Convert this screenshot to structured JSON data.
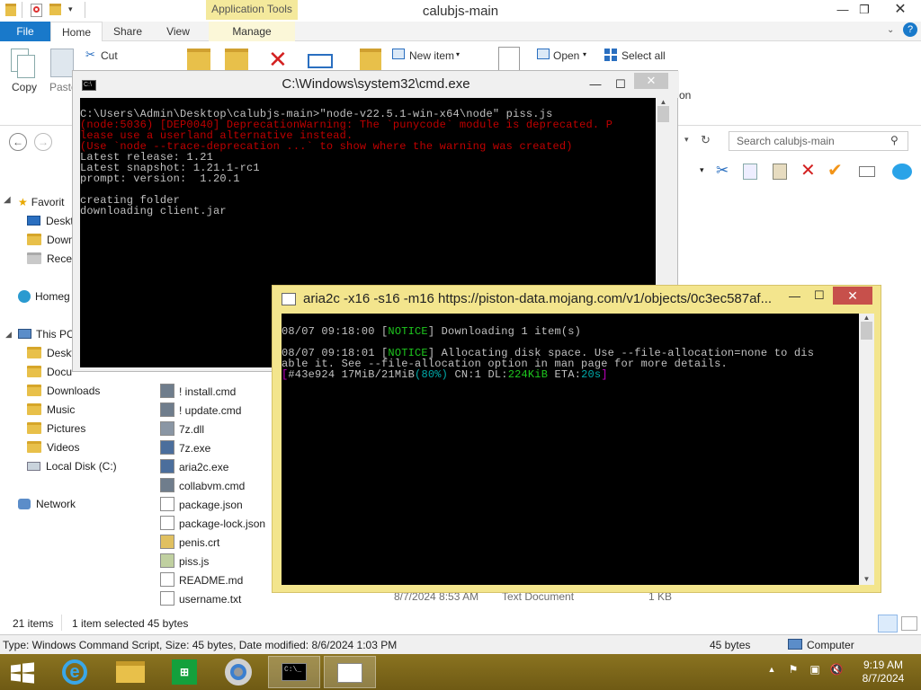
{
  "explorer": {
    "title": "calubjs-main",
    "app_tools": "Application Tools",
    "tabs": [
      "File",
      "Home",
      "Share",
      "View",
      "Manage"
    ],
    "ribbon": {
      "copy": "Copy",
      "paste": "Paste",
      "cut": "Cut",
      "new_item": "New item",
      "open": "Open",
      "select_all": "Select all",
      "selection_partial": "on"
    },
    "search_placeholder": "Search calubjs-main",
    "nav_pane": [
      "Favorites",
      "Desktop",
      "Downloads",
      "Recent places",
      "Homegroup",
      "This PC",
      "Desktop",
      "Documents",
      "Downloads",
      "Music",
      "Pictures",
      "Videos",
      "Local Disk (C:)",
      "Network"
    ],
    "nav_pane_visible": [
      "Favorit",
      "Deskt",
      "Down",
      "Recer",
      "Homeg",
      "This PC",
      "Deskt",
      "Docu",
      "Downloads",
      "Music",
      "Pictures",
      "Videos",
      "Local Disk (C:)",
      "Network"
    ],
    "files": [
      {
        "name": "! install.cmd",
        "icon": "cmd-script-icon"
      },
      {
        "name": "! update.cmd",
        "icon": "cmd-script-icon"
      },
      {
        "name": "7z.dll",
        "icon": "dll-icon"
      },
      {
        "name": "7z.exe",
        "icon": "exe-icon"
      },
      {
        "name": "aria2c.exe",
        "icon": "exe-icon"
      },
      {
        "name": "collabvm.cmd",
        "icon": "cmd-script-icon"
      },
      {
        "name": "package.json",
        "icon": "file-icon"
      },
      {
        "name": "package-lock.json",
        "icon": "file-icon"
      },
      {
        "name": "penis.crt",
        "icon": "certificate-icon"
      },
      {
        "name": "piss.js",
        "icon": "script-icon"
      },
      {
        "name": "README.md",
        "icon": "file-icon"
      },
      {
        "name": "username.txt",
        "icon": "text-file-icon"
      }
    ],
    "last_row": {
      "date": "8/7/2024 8:53 AM",
      "type": "Text Document",
      "size": "1 KB"
    },
    "status": {
      "items": "21 items",
      "selected": "1 item selected",
      "selected_size": "45 bytes"
    },
    "info": {
      "details": "Type: Windows Command Script, Size: 45 bytes, Date modified: 8/6/2024 1:03 PM",
      "size": "45 bytes",
      "location": "Computer"
    }
  },
  "cmd": {
    "title": "C:\\Windows\\system32\\cmd.exe",
    "lines": [
      {
        "text": "C:\\Users\\Admin\\Desktop\\calubjs-main>\"node-v22.5.1-win-x64\\node\" piss.js",
        "red": false
      },
      {
        "text": "(node:5036) [DEP0040] DeprecationWarning: The `punycode` module is deprecated. P",
        "red": true
      },
      {
        "text": "lease use a userland alternative instead.",
        "red": true
      },
      {
        "text": "(Use `node --trace-deprecation ...` to show where the warning was created)",
        "red": true
      },
      {
        "text": "Latest release: 1.21",
        "red": false
      },
      {
        "text": "Latest snapshot: 1.21.1-rc1",
        "red": false
      },
      {
        "text": "prompt: version:  1.20.1",
        "red": false
      },
      {
        "text": "",
        "red": false
      },
      {
        "text": "creating folder",
        "red": false
      },
      {
        "text": "downloading client.jar",
        "red": false
      }
    ]
  },
  "aria": {
    "title": "aria2c  -x16 -s16 -m16 https://piston-data.mojang.com/v1/objects/0c3ec587af...",
    "line1_time": "08/07 09:18:00 [",
    "line1_tag": "NOTICE",
    "line1_rest": "] Downloading 1 item(s)",
    "line2_time": "08/07 09:18:01 [",
    "line2_tag": "NOTICE",
    "line2_rest": "] Allocating disk space. Use --file-allocation=none to dis",
    "line3": "able it. See --file-allocation option in man page for more details.",
    "progress": {
      "open": "[",
      "gid": "#43e924",
      "amount": " 17MiB/21MiB",
      "pct": "(80%)",
      "cn": " CN:1 DL:",
      "dl": "224KiB",
      "eta_label": " ETA:",
      "eta": "20s",
      "close": "]"
    }
  },
  "taskbar": {
    "time": "9:19 AM",
    "date": "8/7/2024"
  },
  "colors": {
    "file_tab": "#1979ca",
    "app_tools": "#f4e99c",
    "taskbar": "#7c6417",
    "close_button": "#c7504b",
    "aria_frame": "#f3e58d",
    "notice_green": "#1ec71e",
    "warning_red": "#c00000"
  }
}
